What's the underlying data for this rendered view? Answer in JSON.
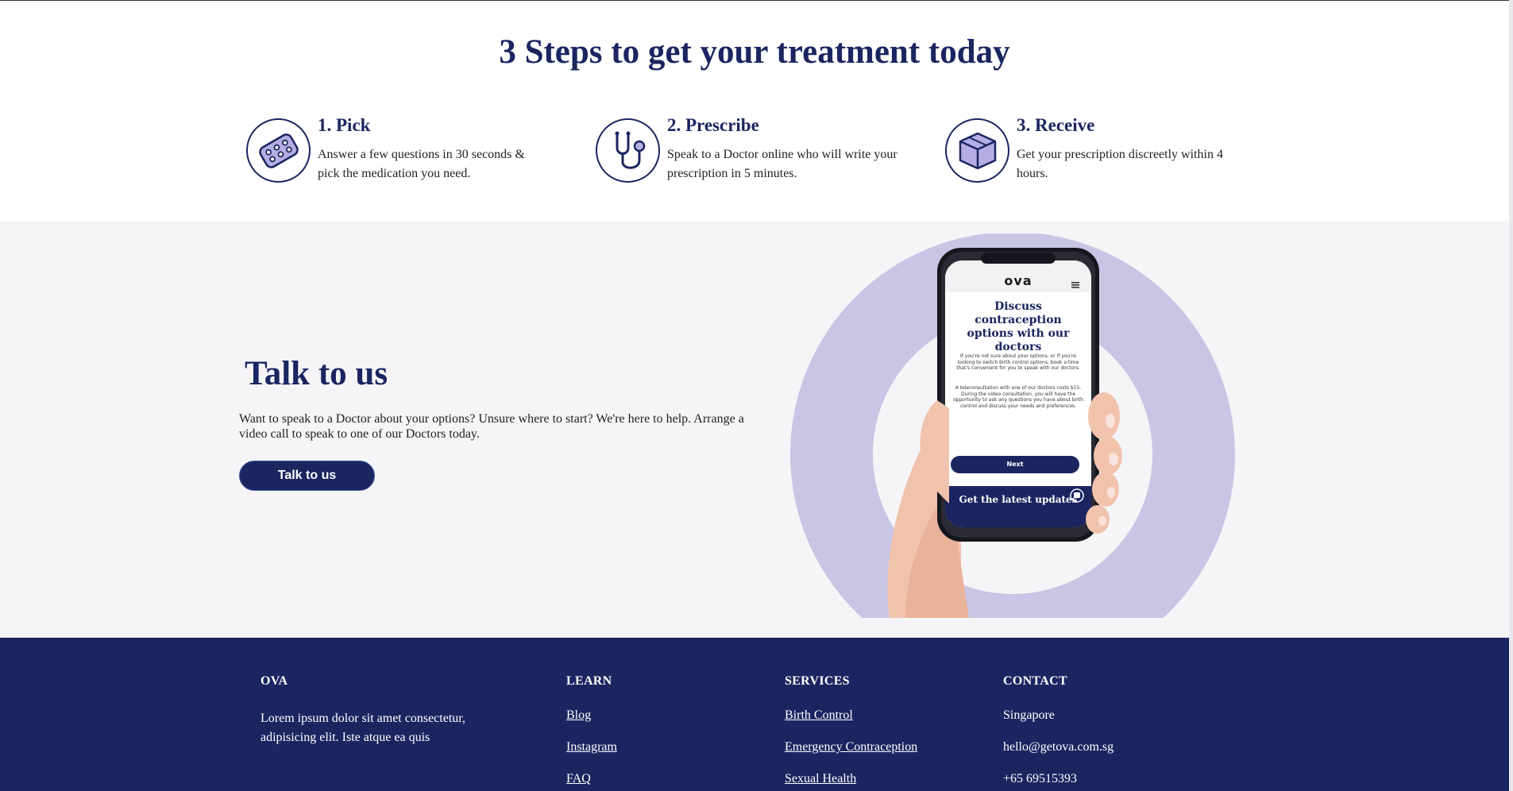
{
  "steps": {
    "title": "3 Steps to get your treatment today",
    "items": [
      {
        "title": "1. Pick",
        "desc": "Answer a few questions in 30 seconds & pick the medication you need.",
        "icon": "pill-pack-icon"
      },
      {
        "title": "2. Prescribe",
        "desc": "Speak to a Doctor online who will write your prescription in 5 minutes.",
        "icon": "stethoscope-icon"
      },
      {
        "title": "3. Receive",
        "desc": "Get your prescription discreetly within 4 hours.",
        "icon": "box-icon"
      }
    ]
  },
  "talk": {
    "title": "Talk to us",
    "desc": "Want to speak to a Doctor about your options? Unsure where to start? We're here to help. Arrange a video call to speak to one of our Doctors today.",
    "button": "Talk to us"
  },
  "phone": {
    "logo": "ova",
    "heading": "Discuss contraception options with our doctors",
    "para1": "If you're not sure about your options, or if you're looking to switch birth control options, book a time that's convenient for you to speak with our doctors.",
    "para2": "A teleconsultation with one of our doctors costs $15. During the video consultation, you will have the opportunity to ask any questions you have about birth control and discuss your needs and preferences.",
    "next": "Next",
    "banner": "Get the latest updates"
  },
  "footer": {
    "ova": {
      "heading": "OVA",
      "text": "Lorem ipsum dolor sit amet consectetur, adipisicing elit. Iste atque ea quis"
    },
    "learn": {
      "heading": "LEARN",
      "links": [
        "Blog",
        "Instagram",
        "FAQ"
      ]
    },
    "services": {
      "heading": "SERVICES",
      "links": [
        "Birth Control",
        "Emergency Contraception",
        "Sexual Health"
      ]
    },
    "contact": {
      "heading": "CONTACT",
      "lines": [
        "Singapore",
        "hello@getova.com.sg",
        "+65 69515393"
      ]
    }
  },
  "colors": {
    "navy": "#1b2560",
    "lavender": "#c8c6e4",
    "section_bg": "#f5f5f8"
  }
}
